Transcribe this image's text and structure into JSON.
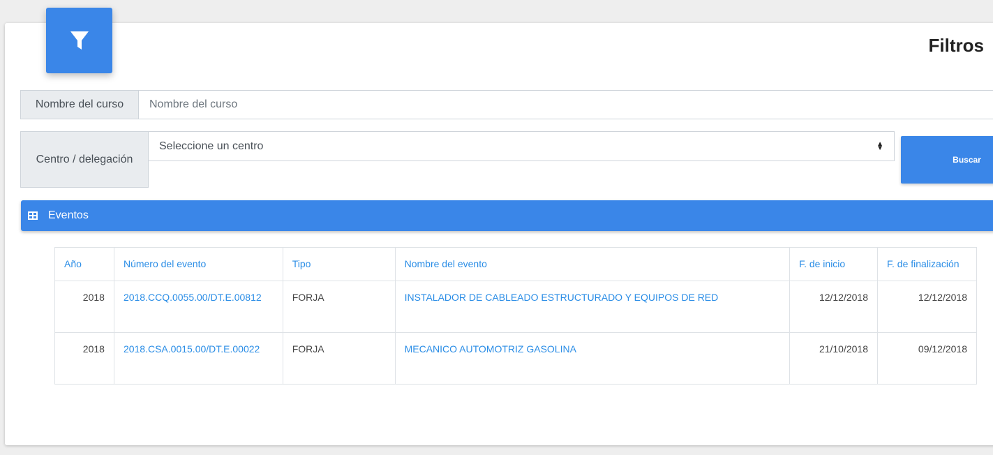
{
  "filters": {
    "title": "Filtros",
    "icon": "filter-icon",
    "course_name": {
      "label": "Nombre del curso",
      "value": "",
      "placeholder": "Nombre del curso"
    },
    "center": {
      "label": "Centro / delegación",
      "selected": "Seleccione un centro"
    },
    "search_button": "Buscar"
  },
  "events_panel": {
    "title": "Eventos",
    "icon": "table-icon",
    "columns": {
      "year": "Año",
      "number": "Número del evento",
      "type": "Tipo",
      "name": "Nombre del evento",
      "start": "F. de inicio",
      "end": "F. de finalización"
    },
    "rows": [
      {
        "year": "2018",
        "number": "2018.CCQ.0055.00/DT.E.00812",
        "type": "FORJA",
        "name": "INSTALADOR DE CABLEADO ESTRUCTURADO Y EQUIPOS DE RED",
        "start": "12/12/2018",
        "end": "12/12/2018"
      },
      {
        "year": "2018",
        "number": "2018.CSA.0015.00/DT.E.00022",
        "type": "FORJA",
        "name": "MECANICO AUTOMOTRIZ GASOLINA",
        "start": "21/10/2018",
        "end": "09/12/2018"
      }
    ]
  },
  "colors": {
    "primary": "#3a86e8",
    "link": "#2a8de6",
    "addon_bg": "#e9ecef",
    "page_bg": "#eeeeee"
  }
}
